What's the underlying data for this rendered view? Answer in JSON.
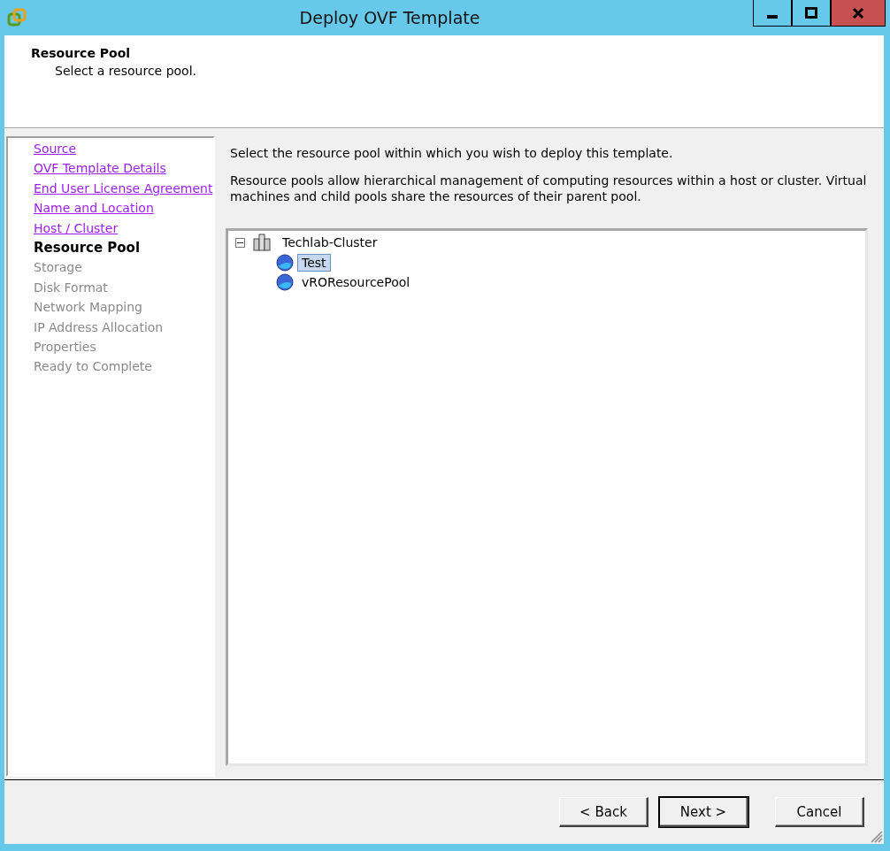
{
  "window": {
    "title": "Deploy OVF Template"
  },
  "header": {
    "title": "Resource Pool",
    "subtitle": "Select a resource pool."
  },
  "steps": [
    {
      "label": "Source",
      "kind": "link"
    },
    {
      "label": "OVF Template Details",
      "kind": "link"
    },
    {
      "label": "End User License Agreement",
      "kind": "link"
    },
    {
      "label": "Name and Location",
      "kind": "link"
    },
    {
      "label": "Host / Cluster",
      "kind": "link"
    },
    {
      "label": "Resource Pool",
      "kind": "current"
    },
    {
      "label": "Storage",
      "kind": "pending"
    },
    {
      "label": "Disk Format",
      "kind": "pending"
    },
    {
      "label": "Network Mapping",
      "kind": "pending"
    },
    {
      "label": "IP Address Allocation",
      "kind": "pending"
    },
    {
      "label": "Properties",
      "kind": "pending"
    },
    {
      "label": "Ready to Complete",
      "kind": "pending"
    }
  ],
  "instructions": [
    "Select the resource pool within which you wish to deploy this template.",
    "Resource pools allow hierarchical management of computing resources within a host or cluster. Virtual machines and child pools share the resources of their parent pool."
  ],
  "tree": [
    {
      "label": "Techlab-Cluster",
      "kind": "cluster",
      "expanded": true,
      "selected": false,
      "children": [
        {
          "label": "Test",
          "kind": "pool",
          "selected": true
        },
        {
          "label": "vROResourcePool",
          "kind": "pool",
          "selected": false
        }
      ]
    }
  ],
  "buttons": [
    {
      "label": "< Back",
      "default": false
    },
    {
      "label": "Next >",
      "default": true
    },
    {
      "label": "Cancel",
      "default": false
    }
  ]
}
